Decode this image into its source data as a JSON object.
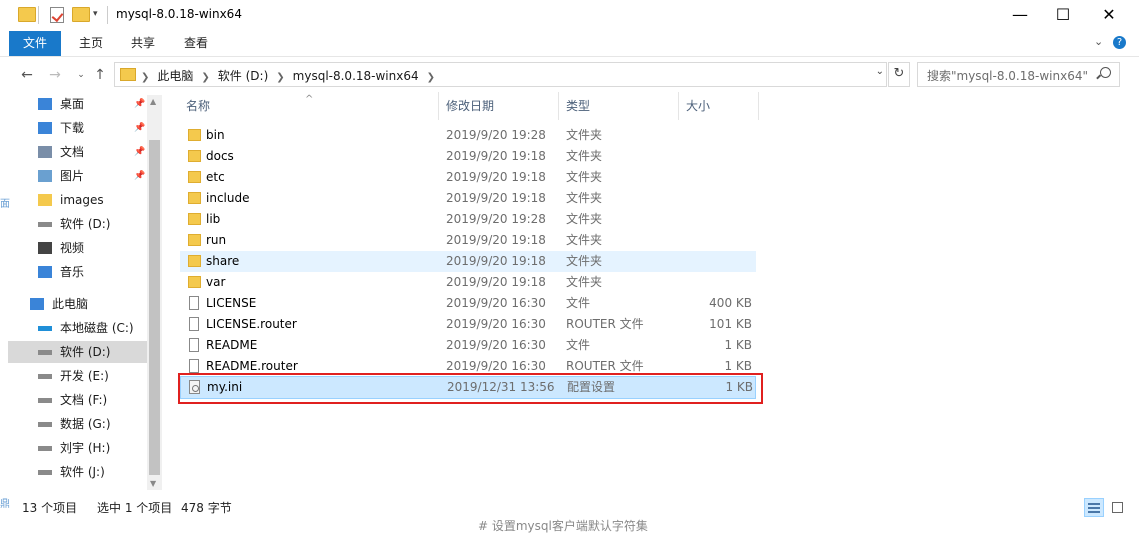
{
  "window": {
    "title": "mysql-8.0.18-winx64",
    "controls": {
      "minimize": "—",
      "maximize": "☐",
      "close": "✕"
    }
  },
  "ribbon": {
    "tabs": [
      "文件",
      "主页",
      "共享",
      "查看"
    ],
    "active_tab": "文件",
    "expand_glyph": "⌄",
    "help_glyph": "?"
  },
  "addressbar": {
    "crumbs": [
      "此电脑",
      "软件 (D:)",
      "mysql-8.0.18-winx64"
    ],
    "search_placeholder": "搜索\"mysql-8.0.18-winx64\""
  },
  "navpane": {
    "items": [
      {
        "label": "桌面",
        "icon": "desktop-icon",
        "pinned": true
      },
      {
        "label": "下载",
        "icon": "download-icon",
        "pinned": true
      },
      {
        "label": "文档",
        "icon": "document-icon",
        "pinned": true
      },
      {
        "label": "图片",
        "icon": "picture-icon",
        "pinned": true
      },
      {
        "label": "images",
        "icon": "folder-icon",
        "pinned": false
      },
      {
        "label": "软件 (D:)",
        "icon": "drive-icon",
        "pinned": false
      },
      {
        "label": "视频",
        "icon": "video-icon",
        "pinned": false
      },
      {
        "label": "音乐",
        "icon": "music-icon",
        "pinned": false
      },
      {
        "label": "此电脑",
        "icon": "computer-icon",
        "pinned": false
      },
      {
        "label": "本地磁盘 (C:)",
        "icon": "windows-drive-icon",
        "pinned": false
      },
      {
        "label": "软件 (D:)",
        "icon": "drive-icon",
        "pinned": false,
        "selected": true
      },
      {
        "label": "开发 (E:)",
        "icon": "drive-icon",
        "pinned": false
      },
      {
        "label": "文档 (F:)",
        "icon": "drive-icon",
        "pinned": false
      },
      {
        "label": "数据 (G:)",
        "icon": "drive-icon",
        "pinned": false
      },
      {
        "label": "刘宇 (H:)",
        "icon": "drive-icon",
        "pinned": false
      },
      {
        "label": "软件 (J:)",
        "icon": "drive-icon",
        "pinned": false
      }
    ]
  },
  "filelist": {
    "columns": {
      "name": "名称",
      "date": "修改日期",
      "type": "类型",
      "size": "大小"
    },
    "rows": [
      {
        "name": "bin",
        "date": "2019/9/20 19:28",
        "type": "文件夹",
        "size": "",
        "kind": "folder"
      },
      {
        "name": "docs",
        "date": "2019/9/20 19:18",
        "type": "文件夹",
        "size": "",
        "kind": "folder"
      },
      {
        "name": "etc",
        "date": "2019/9/20 19:18",
        "type": "文件夹",
        "size": "",
        "kind": "folder"
      },
      {
        "name": "include",
        "date": "2019/9/20 19:18",
        "type": "文件夹",
        "size": "",
        "kind": "folder"
      },
      {
        "name": "lib",
        "date": "2019/9/20 19:28",
        "type": "文件夹",
        "size": "",
        "kind": "folder"
      },
      {
        "name": "run",
        "date": "2019/9/20 19:18",
        "type": "文件夹",
        "size": "",
        "kind": "folder"
      },
      {
        "name": "share",
        "date": "2019/9/20 19:18",
        "type": "文件夹",
        "size": "",
        "kind": "folder",
        "hover": true
      },
      {
        "name": "var",
        "date": "2019/9/20 19:18",
        "type": "文件夹",
        "size": "",
        "kind": "folder"
      },
      {
        "name": "LICENSE",
        "date": "2019/9/20 16:30",
        "type": "文件",
        "size": "400 KB",
        "kind": "file"
      },
      {
        "name": "LICENSE.router",
        "date": "2019/9/20 16:30",
        "type": "ROUTER 文件",
        "size": "101 KB",
        "kind": "file"
      },
      {
        "name": "README",
        "date": "2019/9/20 16:30",
        "type": "文件",
        "size": "1 KB",
        "kind": "file"
      },
      {
        "name": "README.router",
        "date": "2019/9/20 16:30",
        "type": "ROUTER 文件",
        "size": "1 KB",
        "kind": "file"
      },
      {
        "name": "my.ini",
        "date": "2019/12/31 13:56",
        "type": "配置设置",
        "size": "1 KB",
        "kind": "ini",
        "selected": true
      }
    ]
  },
  "statusbar": {
    "count": "13 个项目",
    "selection": "选中 1 个项目",
    "size": "478 字节"
  },
  "background_text": "# 设置mysql客户端默认字符集"
}
